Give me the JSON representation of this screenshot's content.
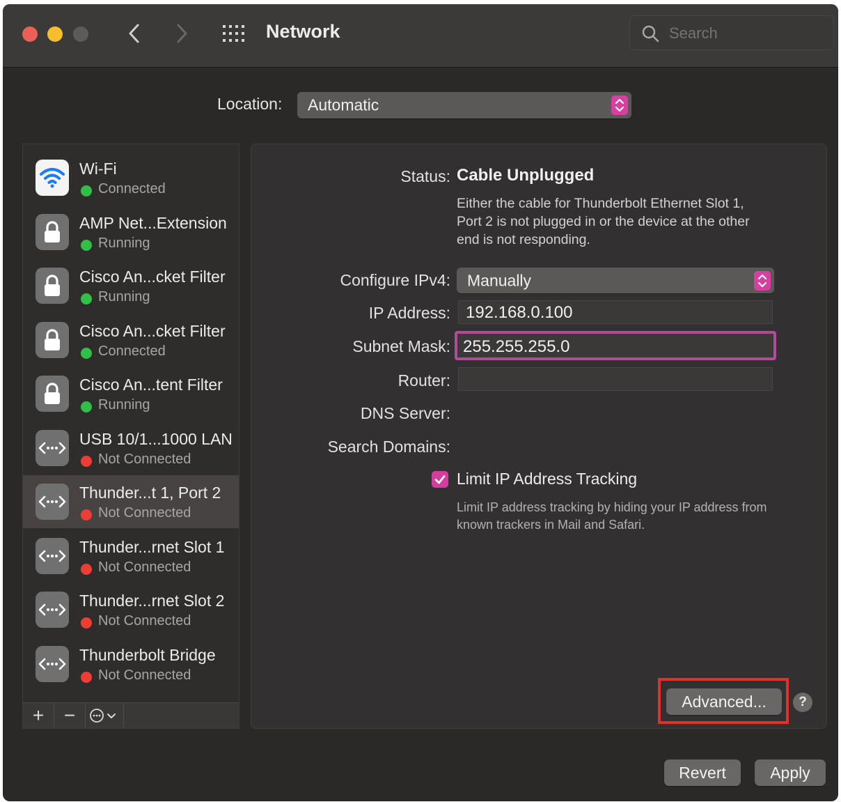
{
  "window": {
    "title": "Network",
    "search_placeholder": "Search",
    "icons": {
      "back": "chevron-left-icon",
      "forward": "chevron-right-icon",
      "grid": "show-all-grid-icon",
      "search": "search-icon"
    }
  },
  "location": {
    "label": "Location:",
    "value": "Automatic"
  },
  "services": [
    {
      "name": "Wi-Fi",
      "status": "Connected",
      "status_color": "#30c048",
      "icon": "wifi-icon"
    },
    {
      "name": "AMP Net...Extension",
      "status": "Running",
      "status_color": "#30c048",
      "icon": "lock-icon"
    },
    {
      "name": "Cisco An...cket Filter",
      "status": "Running",
      "status_color": "#30c048",
      "icon": "lock-icon"
    },
    {
      "name": "Cisco An...cket Filter",
      "status": "Connected",
      "status_color": "#30c048",
      "icon": "lock-icon"
    },
    {
      "name": "Cisco An...tent Filter",
      "status": "Running",
      "status_color": "#30c048",
      "icon": "lock-icon"
    },
    {
      "name": "USB 10/1...1000 LAN",
      "status": "Not Connected",
      "status_color": "#ee3d34",
      "icon": "ethernet-icon"
    },
    {
      "name": "Thunder...t 1, Port 2",
      "status": "Not Connected",
      "status_color": "#ee3d34",
      "icon": "ethernet-icon",
      "selected": true
    },
    {
      "name": "Thunder...rnet Slot 1",
      "status": "Not Connected",
      "status_color": "#ee3d34",
      "icon": "ethernet-icon"
    },
    {
      "name": "Thunder...rnet Slot 2",
      "status": "Not Connected",
      "status_color": "#ee3d34",
      "icon": "ethernet-icon"
    },
    {
      "name": "Thunderbolt Bridge",
      "status": "Not Connected",
      "status_color": "#ee3d34",
      "icon": "ethernet-icon"
    }
  ],
  "sidebar_tools": {
    "add": "+",
    "remove": "−"
  },
  "details": {
    "status_label": "Status:",
    "status_value": "Cable Unplugged",
    "status_description": "Either the cable for Thunderbolt Ethernet Slot 1, Port 2 is not plugged in or the device at the other end is not responding.",
    "configure_label": "Configure IPv4:",
    "configure_value": "Manually",
    "ip_label": "IP Address:",
    "ip_value": "192.168.0.100",
    "subnet_label": "Subnet Mask:",
    "subnet_value": "255.255.255.0",
    "router_label": "Router:",
    "router_value": "",
    "dns_label": "DNS Server:",
    "search_domains_label": "Search Domains:",
    "limit_tracking_label": "Limit IP Address Tracking",
    "limit_tracking_checked": true,
    "limit_tracking_description": "Limit IP address tracking by hiding your IP address from known trackers in Mail and Safari.",
    "advanced_button": "Advanced...",
    "help_button": "?"
  },
  "footer": {
    "revert_button": "Revert",
    "apply_button": "Apply"
  },
  "colors": {
    "accent": "#d63c9f",
    "highlight_box": "#e0312a",
    "connected": "#30c048",
    "disconnected": "#ee3d34"
  }
}
